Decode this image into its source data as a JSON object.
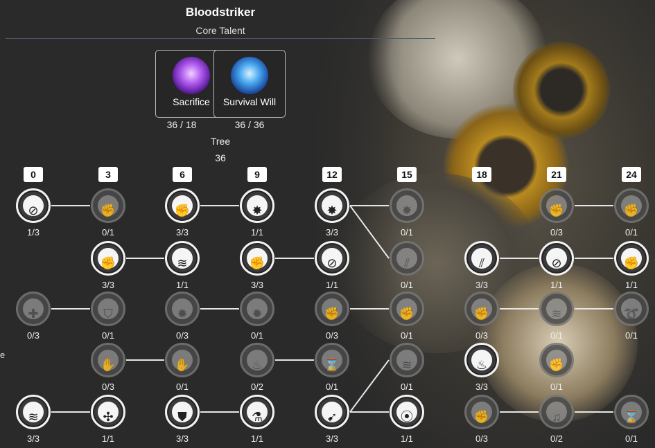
{
  "header": {
    "title": "Bloodstriker",
    "subtitle": "Core Talent"
  },
  "core": [
    {
      "label": "Sacrifice",
      "count": "36 / 18",
      "icon": "sacrifice-icon",
      "color": "#a24de0"
    },
    {
      "label": "Survival Will",
      "count": "36 / 36",
      "icon": "survival-will-icon",
      "color": "#2f7fd8"
    }
  ],
  "tree": {
    "label": "Tree",
    "count": "36"
  },
  "levels": [
    "0",
    "3",
    "6",
    "9",
    "12",
    "15",
    "18",
    "21",
    "24"
  ],
  "edge_text": "e",
  "nodes": [
    {
      "col": 0,
      "row": 0,
      "count": "1/3",
      "on": true,
      "icon": "fist-cancel-icon",
      "glyph": "⊘"
    },
    {
      "col": 1,
      "row": 0,
      "count": "0/1",
      "on": false,
      "icon": "fist-icon",
      "glyph": "✊"
    },
    {
      "col": 2,
      "row": 0,
      "count": "3/3",
      "on": true,
      "icon": "fist-icon",
      "glyph": "✊"
    },
    {
      "col": 3,
      "row": 0,
      "count": "1/1",
      "on": true,
      "icon": "impact-icon",
      "glyph": "✸"
    },
    {
      "col": 4,
      "row": 0,
      "count": "3/3",
      "on": true,
      "icon": "impact-icon",
      "glyph": "✸"
    },
    {
      "col": 5,
      "row": 0,
      "count": "0/1",
      "on": false,
      "icon": "impact-icon",
      "glyph": "✸"
    },
    {
      "col": 7,
      "row": 0,
      "count": "0/3",
      "on": false,
      "icon": "fist-icon",
      "glyph": "✊"
    },
    {
      "col": 8,
      "row": 0,
      "count": "0/1",
      "on": false,
      "icon": "fist-icon",
      "glyph": "✊"
    },
    {
      "col": 1,
      "row": 1,
      "count": "3/3",
      "on": true,
      "icon": "fist-icon",
      "glyph": "✊"
    },
    {
      "col": 2,
      "row": 1,
      "count": "1/1",
      "on": true,
      "icon": "dash-kick-icon",
      "glyph": "≋"
    },
    {
      "col": 3,
      "row": 1,
      "count": "3/3",
      "on": true,
      "icon": "fist-icon",
      "glyph": "✊"
    },
    {
      "col": 4,
      "row": 1,
      "count": "1/1",
      "on": true,
      "icon": "fist-cancel-icon",
      "glyph": "⊘"
    },
    {
      "col": 5,
      "row": 1,
      "count": "0/1",
      "on": false,
      "icon": "claw-strike-icon",
      "glyph": "⫽"
    },
    {
      "col": 6,
      "row": 1,
      "count": "3/3",
      "on": true,
      "icon": "claw-strike-icon",
      "glyph": "⫽"
    },
    {
      "col": 7,
      "row": 1,
      "count": "1/1",
      "on": true,
      "icon": "fist-cancel-icon",
      "glyph": "⊘"
    },
    {
      "col": 8,
      "row": 1,
      "count": "1/1",
      "on": true,
      "icon": "fist-icon",
      "glyph": "✊"
    },
    {
      "col": 0,
      "row": 2,
      "count": "0/3",
      "on": false,
      "icon": "heal-figure-icon",
      "glyph": "✚"
    },
    {
      "col": 1,
      "row": 2,
      "count": "0/1",
      "on": false,
      "icon": "shield-icon",
      "glyph": "⛉"
    },
    {
      "col": 2,
      "row": 2,
      "count": "0/3",
      "on": false,
      "icon": "punch-burst-icon",
      "glyph": "✹"
    },
    {
      "col": 3,
      "row": 2,
      "count": "0/1",
      "on": false,
      "icon": "punch-burst-icon",
      "glyph": "✹"
    },
    {
      "col": 4,
      "row": 2,
      "count": "0/3",
      "on": false,
      "icon": "fist-icon",
      "glyph": "✊"
    },
    {
      "col": 5,
      "row": 2,
      "count": "0/1",
      "on": false,
      "icon": "fist-icon",
      "glyph": "✊"
    },
    {
      "col": 6,
      "row": 2,
      "count": "0/3",
      "on": false,
      "icon": "fist-icon",
      "glyph": "✊"
    },
    {
      "col": 7,
      "row": 2,
      "count": "0/1",
      "on": false,
      "icon": "dash-kick-icon",
      "glyph": "≋"
    },
    {
      "col": 8,
      "row": 2,
      "count": "0/1",
      "on": false,
      "icon": "whirl-strike-icon",
      "glyph": "➰"
    },
    {
      "col": 1,
      "row": 3,
      "count": "0/3",
      "on": false,
      "icon": "spiral-fist-icon",
      "glyph": "✋"
    },
    {
      "col": 2,
      "row": 3,
      "count": "0/1",
      "on": false,
      "icon": "spiral-fist-icon",
      "glyph": "✋"
    },
    {
      "col": 3,
      "row": 3,
      "count": "0/2",
      "on": false,
      "icon": "flame-spirit-icon",
      "glyph": "♨"
    },
    {
      "col": 4,
      "row": 3,
      "count": "0/1",
      "on": false,
      "icon": "hourglass-icon",
      "glyph": "⌛"
    },
    {
      "col": 5,
      "row": 3,
      "count": "0/1",
      "on": false,
      "icon": "dash-kick-icon",
      "glyph": "≋"
    },
    {
      "col": 6,
      "row": 3,
      "count": "3/3",
      "on": true,
      "icon": "burning-fist-icon",
      "glyph": "♨"
    },
    {
      "col": 7,
      "row": 3,
      "count": "0/1",
      "on": false,
      "icon": "fist-icon",
      "glyph": "✊"
    },
    {
      "col": 0,
      "row": 4,
      "count": "3/3",
      "on": true,
      "icon": "dash-kick-icon",
      "glyph": "≋"
    },
    {
      "col": 1,
      "row": 4,
      "count": "1/1",
      "on": true,
      "icon": "triple-arrow-icon",
      "glyph": "✣"
    },
    {
      "col": 2,
      "row": 4,
      "count": "3/3",
      "on": true,
      "icon": "armor-icon",
      "glyph": "⛊"
    },
    {
      "col": 3,
      "row": 4,
      "count": "1/1",
      "on": true,
      "icon": "potion-icon",
      "glyph": "⚗"
    },
    {
      "col": 4,
      "row": 4,
      "count": "3/3",
      "on": true,
      "icon": "swirl-arrow-icon",
      "glyph": "➹"
    },
    {
      "col": 5,
      "row": 4,
      "count": "1/1",
      "on": true,
      "icon": "spin-blade-icon",
      "glyph": "⦿"
    },
    {
      "col": 6,
      "row": 4,
      "count": "0/3",
      "on": false,
      "icon": "fist-icon",
      "glyph": "✊"
    },
    {
      "col": 7,
      "row": 4,
      "count": "0/2",
      "on": false,
      "icon": "music-note-icon",
      "glyph": "♫"
    },
    {
      "col": 8,
      "row": 4,
      "count": "0/1",
      "on": false,
      "icon": "hourglass-icon",
      "glyph": "⌛"
    }
  ],
  "links": [
    [
      0,
      0,
      1,
      0
    ],
    [
      2,
      0,
      3,
      0
    ],
    [
      4,
      0,
      5,
      0
    ],
    [
      4,
      0,
      5,
      1
    ],
    [
      7,
      0,
      8,
      0
    ],
    [
      1,
      1,
      2,
      1
    ],
    [
      3,
      1,
      4,
      1
    ],
    [
      6,
      1,
      7,
      1
    ],
    [
      7,
      1,
      8,
      1
    ],
    [
      0,
      2,
      1,
      2
    ],
    [
      2,
      2,
      3,
      2
    ],
    [
      4,
      2,
      5,
      2
    ],
    [
      6,
      2,
      7,
      2
    ],
    [
      7,
      2,
      8,
      2
    ],
    [
      1,
      3,
      2,
      3
    ],
    [
      3,
      3,
      4,
      3
    ],
    [
      4,
      4,
      5,
      3
    ],
    [
      0,
      4,
      1,
      4
    ],
    [
      2,
      4,
      3,
      4
    ],
    [
      4,
      4,
      5,
      4
    ],
    [
      6,
      4,
      7,
      4
    ],
    [
      7,
      4,
      8,
      4
    ]
  ]
}
